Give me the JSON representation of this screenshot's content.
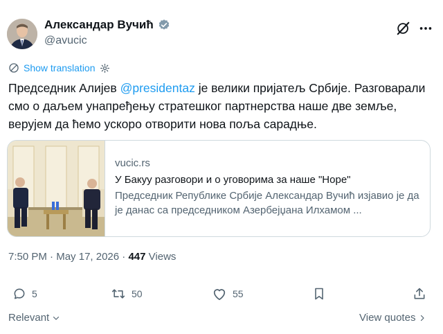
{
  "author": {
    "name": "Александар Вучић",
    "handle": "@avucic"
  },
  "translation": {
    "label": "Show translation"
  },
  "post": {
    "text_before": "Председник Алијев ",
    "mention": "@presidentaz",
    "text_after": " је велики пријатељ Србије. Разговарали смо о даљем унапређењу стратешког партнерства наше две земље, верујем да ћемо ускоро отворити нова поља сарадње."
  },
  "card": {
    "domain": "vucic.rs",
    "title": "У Бакуу разговори и о уговорима за наше \"Норе\"",
    "description": "Председник Републике Србије Александар Вучић изјавио је да је данас са председником Азербејџана Илхамом ..."
  },
  "meta": {
    "time": "7:50 PM",
    "separator": " · ",
    "date": "May 17, 2026",
    "views_count": "447",
    "views_label": " Views"
  },
  "actions": {
    "replies": "5",
    "reposts": "50",
    "likes": "55"
  },
  "footer": {
    "sort_label": "Relevant",
    "view_quotes": "View quotes"
  },
  "colors": {
    "accent": "#1d9bf0",
    "muted": "#536471",
    "text": "#0f1419",
    "border": "#cfd9de"
  }
}
